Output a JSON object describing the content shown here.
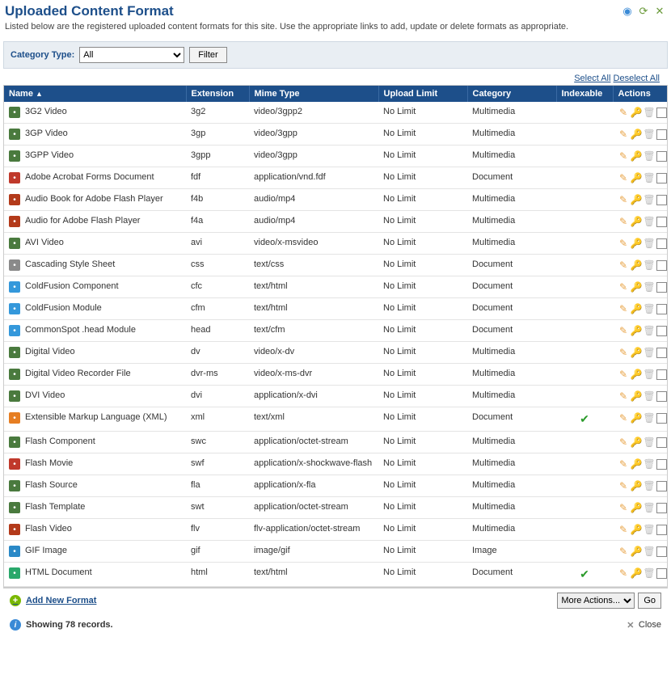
{
  "header": {
    "title": "Uploaded Content Format",
    "subtitle": "Listed below are the registered uploaded content formats for this site. Use the appropriate links to add, update or delete formats as appropriate."
  },
  "filter": {
    "label": "Category Type:",
    "selected": "All",
    "button": "Filter"
  },
  "links": {
    "select_all": "Select All",
    "deselect_all": "Deselect All",
    "add_new": "Add New Format",
    "close": "Close"
  },
  "columns": {
    "name": "Name",
    "extension": "Extension",
    "mime": "Mime Type",
    "limit": "Upload Limit",
    "category": "Category",
    "indexable": "Indexable",
    "actions": "Actions"
  },
  "more_actions": {
    "label": "More Actions...",
    "go": "Go"
  },
  "status": "Showing 78 records.",
  "rows": [
    {
      "name": "3G2 Video",
      "ext": "3g2",
      "mime": "video/3gpp2",
      "limit": "No Limit",
      "cat": "Multimedia",
      "indexable": false,
      "icon_color": "#4a7a3e"
    },
    {
      "name": "3GP Video",
      "ext": "3gp",
      "mime": "video/3gpp",
      "limit": "No Limit",
      "cat": "Multimedia",
      "indexable": false,
      "icon_color": "#4a7a3e"
    },
    {
      "name": "3GPP Video",
      "ext": "3gpp",
      "mime": "video/3gpp",
      "limit": "No Limit",
      "cat": "Multimedia",
      "indexable": false,
      "icon_color": "#4a7a3e"
    },
    {
      "name": "Adobe Acrobat Forms Document",
      "ext": "fdf",
      "mime": "application/vnd.fdf",
      "limit": "No Limit",
      "cat": "Document",
      "indexable": false,
      "icon_color": "#c0392b"
    },
    {
      "name": "Audio Book for Adobe Flash Player",
      "ext": "f4b",
      "mime": "audio/mp4",
      "limit": "No Limit",
      "cat": "Multimedia",
      "indexable": false,
      "icon_color": "#b33a1a"
    },
    {
      "name": "Audio for Adobe Flash Player",
      "ext": "f4a",
      "mime": "audio/mp4",
      "limit": "No Limit",
      "cat": "Multimedia",
      "indexable": false,
      "icon_color": "#b33a1a"
    },
    {
      "name": "AVI Video",
      "ext": "avi",
      "mime": "video/x-msvideo",
      "limit": "No Limit",
      "cat": "Multimedia",
      "indexable": false,
      "icon_color": "#4a7a3e"
    },
    {
      "name": "Cascading Style Sheet",
      "ext": "css",
      "mime": "text/css",
      "limit": "No Limit",
      "cat": "Document",
      "indexable": false,
      "icon_color": "#8a8a8a"
    },
    {
      "name": "ColdFusion Component",
      "ext": "cfc",
      "mime": "text/html",
      "limit": "No Limit",
      "cat": "Document",
      "indexable": false,
      "icon_color": "#3498db"
    },
    {
      "name": "ColdFusion Module",
      "ext": "cfm",
      "mime": "text/html",
      "limit": "No Limit",
      "cat": "Document",
      "indexable": false,
      "icon_color": "#3498db"
    },
    {
      "name": "CommonSpot .head Module",
      "ext": "head",
      "mime": "text/cfm",
      "limit": "No Limit",
      "cat": "Document",
      "indexable": false,
      "icon_color": "#3498db"
    },
    {
      "name": "Digital Video",
      "ext": "dv",
      "mime": "video/x-dv",
      "limit": "No Limit",
      "cat": "Multimedia",
      "indexable": false,
      "icon_color": "#4a7a3e"
    },
    {
      "name": "Digital Video Recorder File",
      "ext": "dvr-ms",
      "mime": "video/x-ms-dvr",
      "limit": "No Limit",
      "cat": "Multimedia",
      "indexable": false,
      "icon_color": "#4a7a3e"
    },
    {
      "name": "DVI Video",
      "ext": "dvi",
      "mime": "application/x-dvi",
      "limit": "No Limit",
      "cat": "Multimedia",
      "indexable": false,
      "icon_color": "#4a7a3e"
    },
    {
      "name": "Extensible Markup Language (XML)",
      "ext": "xml",
      "mime": "text/xml",
      "limit": "No Limit",
      "cat": "Document",
      "indexable": true,
      "icon_color": "#e67e22"
    },
    {
      "name": "Flash Component",
      "ext": "swc",
      "mime": "application/octet-stream",
      "limit": "No Limit",
      "cat": "Multimedia",
      "indexable": false,
      "icon_color": "#4a7a3e"
    },
    {
      "name": "Flash Movie",
      "ext": "swf",
      "mime": "application/x-shockwave-flash",
      "limit": "No Limit",
      "cat": "Multimedia",
      "indexable": false,
      "icon_color": "#c0392b"
    },
    {
      "name": "Flash Source",
      "ext": "fla",
      "mime": "application/x-fla",
      "limit": "No Limit",
      "cat": "Multimedia",
      "indexable": false,
      "icon_color": "#4a7a3e"
    },
    {
      "name": "Flash Template",
      "ext": "swt",
      "mime": "application/octet-stream",
      "limit": "No Limit",
      "cat": "Multimedia",
      "indexable": false,
      "icon_color": "#4a7a3e"
    },
    {
      "name": "Flash Video",
      "ext": "flv",
      "mime": "flv-application/octet-stream",
      "limit": "No Limit",
      "cat": "Multimedia",
      "indexable": false,
      "icon_color": "#b33a1a"
    },
    {
      "name": "GIF Image",
      "ext": "gif",
      "mime": "image/gif",
      "limit": "No Limit",
      "cat": "Image",
      "indexable": false,
      "icon_color": "#2a89c7"
    },
    {
      "name": "HTML Document",
      "ext": "html",
      "mime": "text/html",
      "limit": "No Limit",
      "cat": "Document",
      "indexable": true,
      "icon_color": "#2aa86b"
    }
  ]
}
